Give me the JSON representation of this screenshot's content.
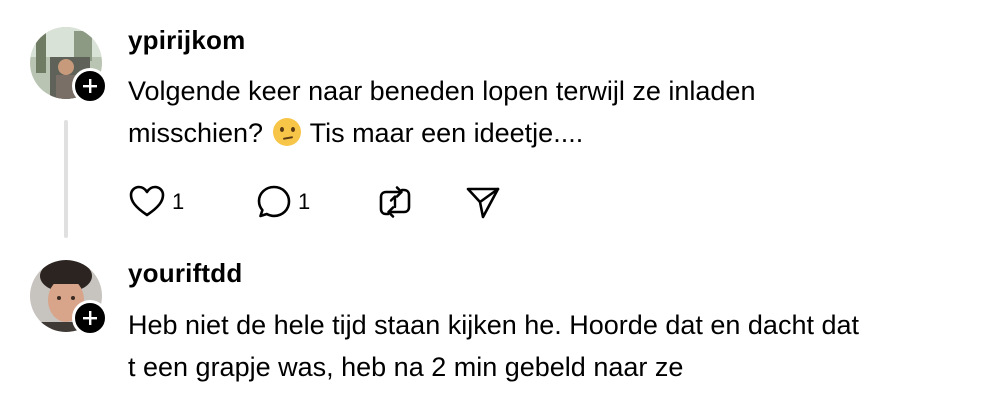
{
  "comments": [
    {
      "username": "ypirijkom",
      "text_line1": "Volgende keer naar beneden lopen terwijl ze inladen",
      "text_line2_before_emoji": "misschien? ",
      "emoji": "thinking-face",
      "text_line2_after_emoji": " Tis maar een ideetje....",
      "likes": "1",
      "replies": "1"
    },
    {
      "username": "youriftdd",
      "text_line1": "Heb niet de hele tijd staan kijken he. Hoorde dat en dacht dat",
      "text_line2": "t een grapje was, heb na 2 min gebeld naar ze"
    }
  ],
  "colors": {
    "text": "#000000",
    "thread_line": "#e0e0e0",
    "badge": "#000000",
    "background": "#ffffff"
  },
  "icons": [
    "heart-icon",
    "comment-icon",
    "repost-icon",
    "share-icon",
    "plus-icon"
  ]
}
